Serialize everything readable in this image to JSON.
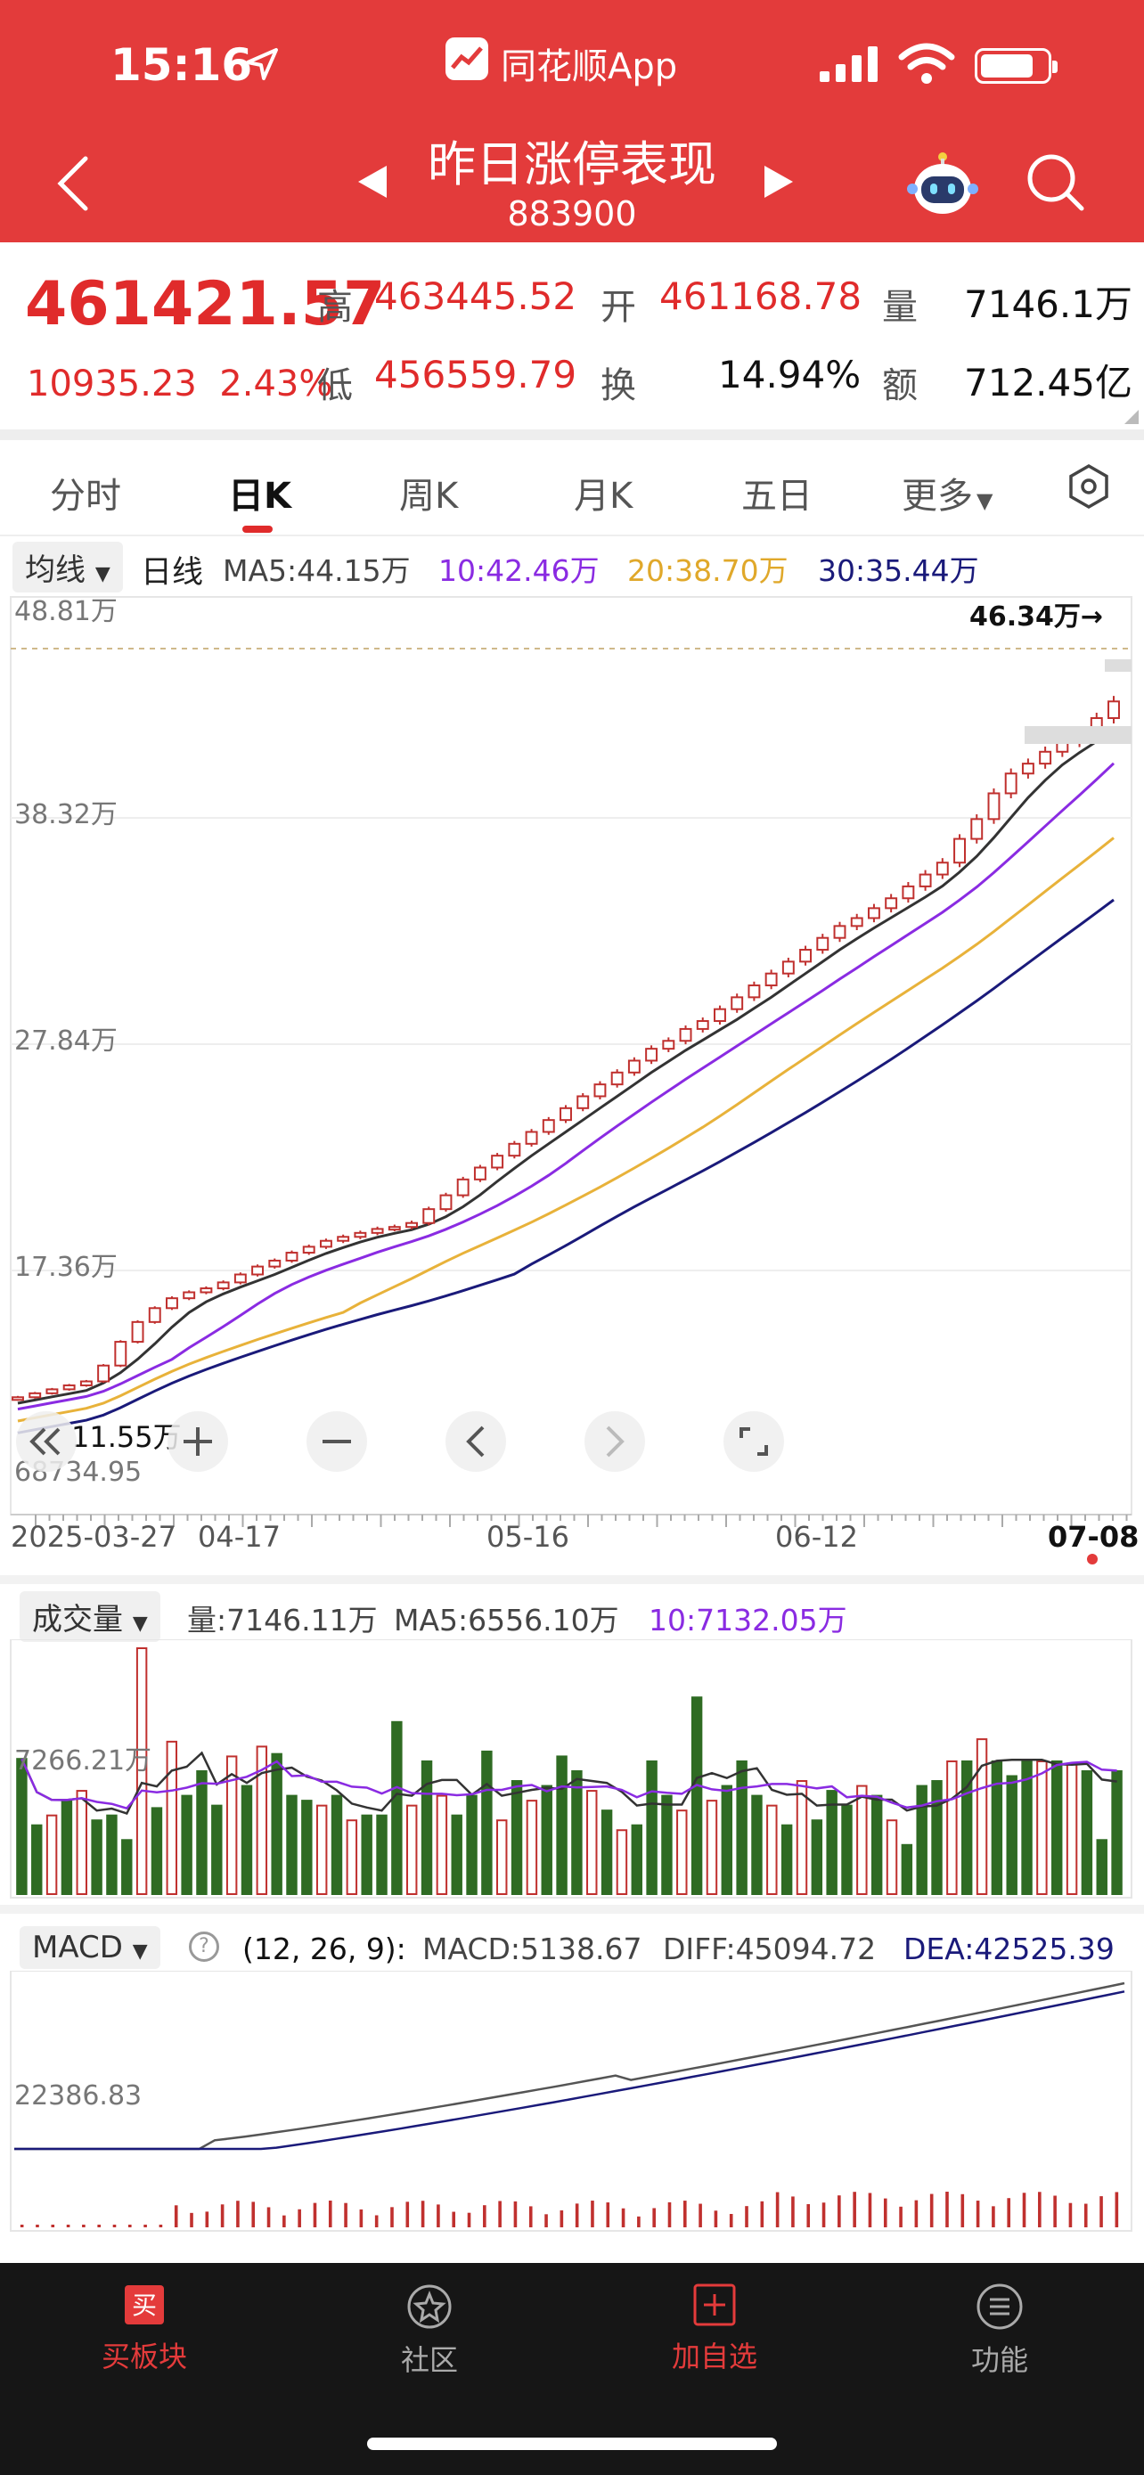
{
  "status_bar": {
    "time": "15:16",
    "app_name": "同花顺App"
  },
  "header": {
    "title": "昨日涨停表现",
    "code": "883900"
  },
  "quote": {
    "price": "461421.57",
    "change": "10935.23",
    "change_pct": "2.43%",
    "high_label": "高",
    "high": "463445.52",
    "low_label": "低",
    "low": "456559.79",
    "open_label": "开",
    "open": "461168.78",
    "turnover_label": "换",
    "turnover": "14.94%",
    "volume_label": "量",
    "volume": "7146.1万",
    "amount_label": "额",
    "amount": "712.45亿"
  },
  "tabs": [
    "分时",
    "日K",
    "周K",
    "月K",
    "五日",
    "更多"
  ],
  "ma_row": {
    "selector": "均线",
    "period": "日线",
    "ma5": "MA5:44.15万",
    "ma10": "10:42.46万",
    "ma20": "20:38.70万",
    "ma30": "30:35.44万"
  },
  "price_axis": {
    "top": "48.81万",
    "l2": "38.32万",
    "l3": "27.84万",
    "l4": "17.36万",
    "low_label": "11.55万",
    "bottom": "68734.95"
  },
  "latest_marker": "46.34万→",
  "date_axis": [
    "2025-03-27",
    "04-17",
    "05-16",
    "06-12",
    "07-08"
  ],
  "volume_row": {
    "selector": "成交量",
    "vol": "量:7146.11万",
    "ma5": "MA5:6556.10万",
    "ma10": "10:7132.05万",
    "axis_label": "7266.21万"
  },
  "macd_row": {
    "selector": "MACD",
    "params": "(12, 26, 9):",
    "macd": "MACD:5138.67",
    "diff": "DIFF:45094.72",
    "dea": "DEA:42525.39",
    "axis_label": "22386.83"
  },
  "bottom_nav": [
    "买板块",
    "社区",
    "加自选",
    "功能"
  ],
  "colors": {
    "up": "#c0302e",
    "down": "#2f6b23",
    "ma5": "#333333",
    "ma10": "#8a2be2",
    "ma20": "#e8b23a",
    "ma30": "#1a1a7a",
    "header": "#e33b3b"
  },
  "chart_data": [
    {
      "type": "candlestick",
      "title": "日K",
      "x": [
        "2025-03-27",
        "04-17",
        "05-16",
        "06-12",
        "07-08"
      ],
      "ylim": [
        68734.95,
        488100
      ],
      "series": [
        {
          "name": "MA5",
          "last": 441500
        },
        {
          "name": "MA10",
          "last": 424600
        },
        {
          "name": "MA20",
          "last": 387000
        },
        {
          "name": "MA30",
          "last": 354400
        }
      ],
      "close": [
        110000,
        112000,
        114000,
        116000,
        118000,
        126000,
        138000,
        148000,
        155000,
        160000,
        163000,
        165000,
        168000,
        172000,
        176000,
        179000,
        183000,
        186000,
        189000,
        191000,
        193000,
        195000,
        196000,
        198000,
        205000,
        212000,
        220000,
        226000,
        232000,
        238000,
        244000,
        250000,
        256000,
        262000,
        268000,
        274000,
        280000,
        286000,
        290000,
        296000,
        300000,
        306000,
        312000,
        318000,
        324000,
        330000,
        336000,
        342000,
        348000,
        352000,
        357000,
        362000,
        368000,
        374000,
        380000,
        392000,
        402000,
        415000,
        425000,
        430000,
        436000,
        441000,
        446000,
        453000,
        461421
      ]
    },
    {
      "type": "bar",
      "title": "成交量",
      "values": [
        0.55,
        0.28,
        0.32,
        0.38,
        0.42,
        0.3,
        0.32,
        0.22,
        1.0,
        0.35,
        0.62,
        0.4,
        0.5,
        0.36,
        0.56,
        0.44,
        0.6,
        0.57,
        0.4,
        0.38,
        0.36,
        0.4,
        0.3,
        0.32,
        0.32,
        0.7,
        0.36,
        0.54,
        0.4,
        0.32,
        0.4,
        0.58,
        0.3,
        0.46,
        0.38,
        0.44,
        0.56,
        0.5,
        0.42,
        0.34,
        0.26,
        0.28,
        0.54,
        0.4,
        0.34,
        0.8,
        0.38,
        0.44,
        0.54,
        0.4,
        0.36,
        0.28,
        0.46,
        0.3,
        0.42,
        0.36,
        0.44,
        0.4,
        0.3,
        0.2,
        0.44,
        0.46,
        0.54,
        0.54,
        0.63,
        0.54,
        0.48,
        0.54,
        0.54,
        0.54,
        0.53,
        0.5,
        0.22,
        0.5
      ]
    },
    {
      "type": "line",
      "title": "MACD",
      "series": [
        {
          "name": "DIFF",
          "last": 45094.72
        },
        {
          "name": "DEA",
          "last": 42525.39
        }
      ],
      "macd_last": 5138.67
    }
  ]
}
